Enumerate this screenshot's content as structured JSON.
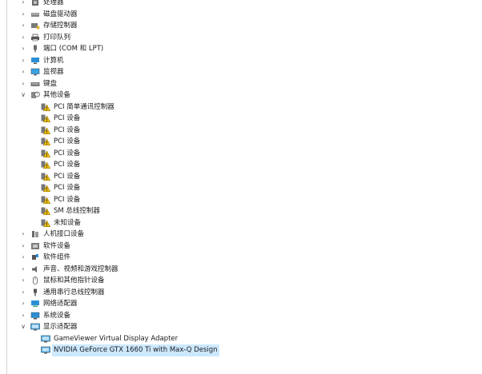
{
  "tree": {
    "items": [
      {
        "label": "处理器",
        "level": 0,
        "icon": "processor-icon",
        "state": "collapsed"
      },
      {
        "label": "磁盘驱动器",
        "level": 0,
        "icon": "disk-drive-icon",
        "state": "collapsed"
      },
      {
        "label": "存储控制器",
        "level": 0,
        "icon": "storage-controller-icon",
        "state": "collapsed"
      },
      {
        "label": "打印队列",
        "level": 0,
        "icon": "printer-icon",
        "state": "collapsed"
      },
      {
        "label": "端口 (COM 和 LPT)",
        "level": 0,
        "icon": "port-icon",
        "state": "collapsed"
      },
      {
        "label": "计算机",
        "level": 0,
        "icon": "computer-icon",
        "state": "collapsed"
      },
      {
        "label": "监视器",
        "level": 0,
        "icon": "monitor-icon",
        "state": "collapsed"
      },
      {
        "label": "键盘",
        "level": 0,
        "icon": "keyboard-icon",
        "state": "collapsed"
      },
      {
        "label": "其他设备",
        "level": 0,
        "icon": "other-devices-icon",
        "state": "expanded"
      },
      {
        "label": "PCI 简单通讯控制器",
        "level": 1,
        "icon": "warning-device-icon"
      },
      {
        "label": "PCI 设备",
        "level": 1,
        "icon": "warning-device-icon"
      },
      {
        "label": "PCI 设备",
        "level": 1,
        "icon": "warning-device-icon"
      },
      {
        "label": "PCI 设备",
        "level": 1,
        "icon": "warning-device-icon"
      },
      {
        "label": "PCI 设备",
        "level": 1,
        "icon": "warning-device-icon"
      },
      {
        "label": "PCI 设备",
        "level": 1,
        "icon": "warning-device-icon"
      },
      {
        "label": "PCI 设备",
        "level": 1,
        "icon": "warning-device-icon"
      },
      {
        "label": "PCI 设备",
        "level": 1,
        "icon": "warning-device-icon"
      },
      {
        "label": "PCI 设备",
        "level": 1,
        "icon": "warning-device-icon"
      },
      {
        "label": "SM 总线控制器",
        "level": 1,
        "icon": "warning-device-icon"
      },
      {
        "label": "未知设备",
        "level": 1,
        "icon": "warning-device-icon"
      },
      {
        "label": "人机接口设备",
        "level": 0,
        "icon": "hid-icon",
        "state": "collapsed"
      },
      {
        "label": "软件设备",
        "level": 0,
        "icon": "software-device-icon",
        "state": "collapsed"
      },
      {
        "label": "软件组件",
        "level": 0,
        "icon": "software-component-icon",
        "state": "collapsed"
      },
      {
        "label": "声音、视频和游戏控制器",
        "level": 0,
        "icon": "audio-icon",
        "state": "collapsed"
      },
      {
        "label": "鼠标和其他指针设备",
        "level": 0,
        "icon": "mouse-icon",
        "state": "collapsed"
      },
      {
        "label": "通用串行总线控制器",
        "level": 0,
        "icon": "usb-icon",
        "state": "collapsed"
      },
      {
        "label": "网络适配器",
        "level": 0,
        "icon": "network-adapter-icon",
        "state": "collapsed"
      },
      {
        "label": "系统设备",
        "level": 0,
        "icon": "system-device-icon",
        "state": "collapsed"
      },
      {
        "label": "显示适配器",
        "level": 0,
        "icon": "display-adapter-icon",
        "state": "expanded"
      },
      {
        "label": "GameViewer Virtual Display Adapter",
        "level": 1,
        "icon": "display-adapter-icon"
      },
      {
        "label": "NVIDIA GeForce GTX 1660 Ti with Max-Q Design",
        "level": 1,
        "icon": "display-adapter-icon",
        "selected": true
      }
    ]
  },
  "colors": {
    "selection": "#cce8ff",
    "warning": "#f2c200",
    "monitor": "#2b8fd6"
  }
}
